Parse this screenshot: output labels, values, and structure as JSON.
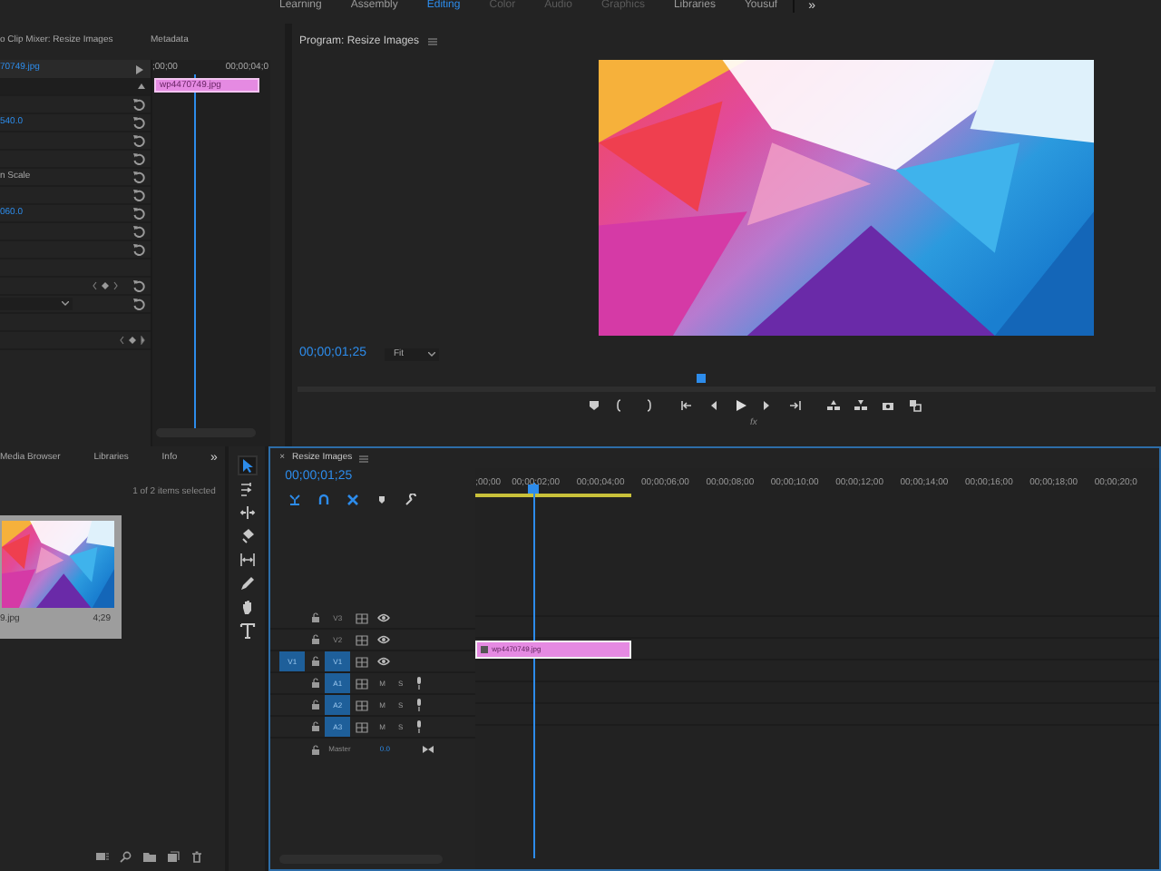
{
  "workspaces": [
    {
      "label": "Learning",
      "selected": false
    },
    {
      "label": "Assembly",
      "selected": false
    },
    {
      "label": "Editing",
      "selected": true
    },
    {
      "label": "Color",
      "selected": false
    },
    {
      "label": "Audio",
      "selected": false
    },
    {
      "label": "Graphics",
      "selected": false
    },
    {
      "label": "Libraries",
      "selected": false
    },
    {
      "label": "Yousuf",
      "selected": false
    }
  ],
  "workspace_overflow": "»",
  "effect_controls": {
    "tabs": [
      "o Clip Mixer: Resize Images",
      "Metadata"
    ],
    "clip_name": "70749.jpg",
    "rows": [
      {
        "kind": "header"
      },
      {
        "kind": "reset"
      },
      {
        "kind": "value",
        "text": "540.0"
      },
      {
        "kind": "reset"
      },
      {
        "kind": "reset"
      },
      {
        "kind": "label",
        "text": "n Scale"
      },
      {
        "kind": "reset"
      },
      {
        "kind": "value",
        "text": "060.0"
      },
      {
        "kind": "reset"
      },
      {
        "kind": "reset"
      },
      {
        "kind": "blank"
      },
      {
        "kind": "keyframe"
      },
      {
        "kind": "dropdown"
      },
      {
        "kind": "blank"
      },
      {
        "kind": "keyframe_only"
      }
    ],
    "ruler": [
      ";00;00",
      "00;00;04;0"
    ],
    "clip": "wp4470749.jpg"
  },
  "program": {
    "title": "Program: Resize Images",
    "timecode": "00;00;01;25",
    "zoom": "Fit",
    "playhead": {
      "level": 0.47
    },
    "fx": "fx"
  },
  "project": {
    "tabs": [
      "Media Browser",
      "Libraries",
      "Info"
    ],
    "overflow": "»",
    "selection_info": "1 of 2 items selected",
    "item": {
      "name": "9.jpg",
      "duration": "4;29",
      "selected": true
    }
  },
  "tools": [
    {
      "selected": true
    },
    {
      "selected": false
    },
    {
      "selected": false
    },
    {
      "selected": false
    },
    {
      "selected": false
    },
    {
      "selected": false
    },
    {
      "selected": false
    },
    {
      "selected": false
    }
  ],
  "timeline": {
    "close": "×",
    "title": "Resize Images",
    "timecode": "00;00;01;25",
    "ruler": [
      ";00;00",
      "00;00;02;00",
      "00;00;04;00",
      "00;00;06;00",
      "00;00;08;00",
      "00;00;10;00",
      "00;00;12;00",
      "00;00;14;00",
      "00;00;16;00",
      "00;00;18;00",
      "00;00;20;0"
    ],
    "tracks": [
      {
        "kind": "video",
        "name": "V3",
        "targeted": false
      },
      {
        "kind": "video",
        "name": "V2",
        "targeted": false
      },
      {
        "kind": "video",
        "name": "V1",
        "targeted": true,
        "source": "V1"
      },
      {
        "kind": "audio",
        "name": "A1",
        "targeted": true,
        "mute": "M",
        "solo": "S"
      },
      {
        "kind": "audio",
        "name": "A2",
        "targeted": true,
        "mute": "M",
        "solo": "S"
      },
      {
        "kind": "audio",
        "name": "A3",
        "targeted": true,
        "mute": "M",
        "solo": "S"
      }
    ],
    "master": {
      "label": "Master",
      "value": "0.0"
    },
    "clip": "wp4470749.jpg"
  }
}
